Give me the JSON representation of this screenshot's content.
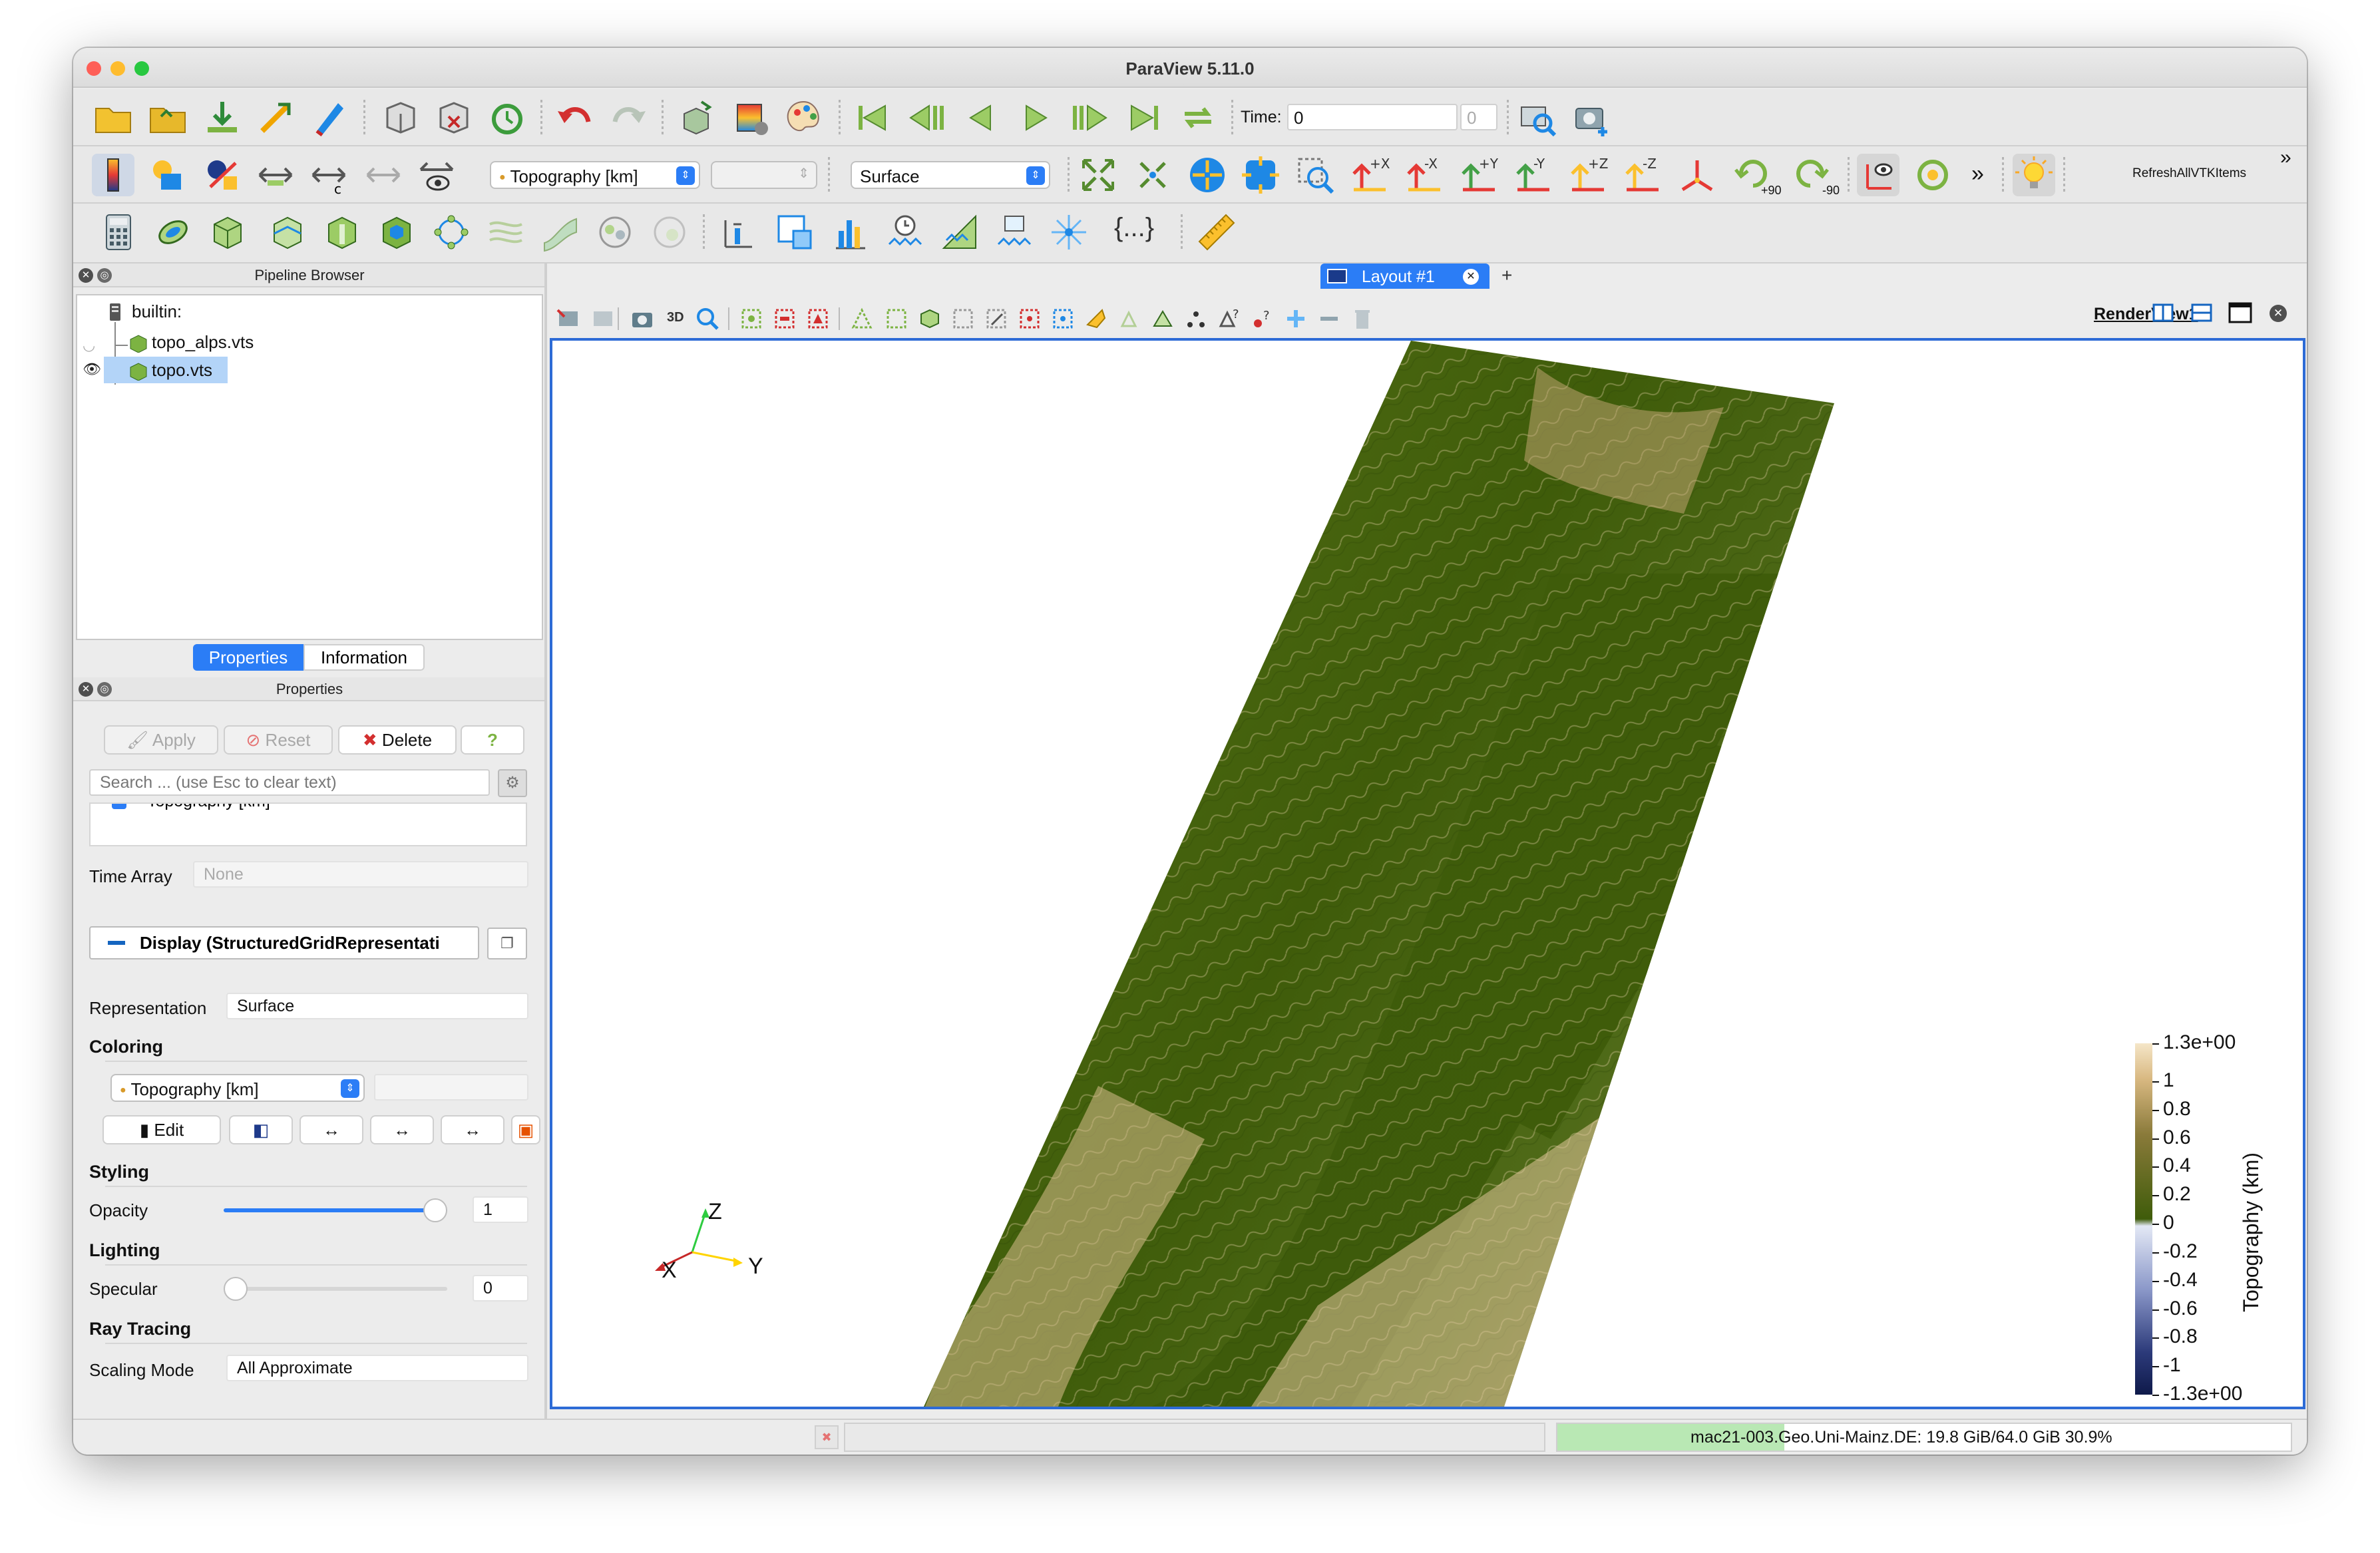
{
  "window": {
    "title": "ParaView 5.11.0"
  },
  "toolbar1": {
    "time_label": "Time:",
    "time_value": "0",
    "time_index": "0"
  },
  "toolbar2": {
    "color_by": "Topography  [km]",
    "component": "",
    "representation": "Surface",
    "camera_labels": [
      "+X",
      "-X",
      "+Y",
      "-Y",
      "+Z",
      "-Z"
    ],
    "rotate_pos": "+90",
    "rotate_neg": "-90",
    "refresh_label": "RefreshAllVTKItems"
  },
  "pipeline": {
    "header": "Pipeline Browser",
    "items": [
      {
        "label": "builtin:"
      },
      {
        "label": "topo_alps.vts"
      },
      {
        "label": "topo.vts"
      }
    ]
  },
  "tabs": {
    "properties": "Properties",
    "information": "Information"
  },
  "properties": {
    "header": "Properties",
    "apply": "Apply",
    "reset": "Reset",
    "delete": "Delete",
    "help": "?",
    "search_placeholder": "Search ... (use Esc to clear text)",
    "partial_row": "Topography  [km]",
    "time_array_label": "Time Array",
    "time_array_value": "None",
    "display_section": "Display (StructuredGridRepresentati",
    "representation_label": "Representation",
    "representation_value": "Surface",
    "coloring_section": "Coloring",
    "coloring_value": "Topography  [km]",
    "edit_label": "Edit",
    "styling_section": "Styling",
    "opacity_label": "Opacity",
    "opacity_value": "1",
    "opacity_fraction": 1.0,
    "lighting_section": "Lighting",
    "specular_label": "Specular",
    "specular_value": "0",
    "specular_fraction": 0.0,
    "raytracing_section": "Ray Tracing",
    "scaling_label": "Scaling Mode",
    "scaling_value": "All Approximate"
  },
  "layout": {
    "tab_label": "Layout #1",
    "add_tab": "+",
    "view_toolbar_3d": "3D",
    "view_name": "RenderView1"
  },
  "axes": {
    "x": "X",
    "y": "Y",
    "z": "Z"
  },
  "colorbar": {
    "title": "Topography  (km)",
    "ticks": [
      "1.3e+00",
      "1",
      "0.8",
      "0.6",
      "0.4",
      "0.2",
      "0",
      "-0.2",
      "-0.4",
      "-0.6",
      "-0.8",
      "-1",
      "-1.3e+00"
    ]
  },
  "status": {
    "memory_text": "mac21-003.Geo.Uni-Mainz.DE: 19.8 GiB/64.0 GiB 30.9%",
    "memory_fraction": 0.309
  },
  "colors": {
    "accent": "#2d6bd6",
    "terrain_dark": "#3f5c0a",
    "terrain_light": "#e8d2a8"
  }
}
